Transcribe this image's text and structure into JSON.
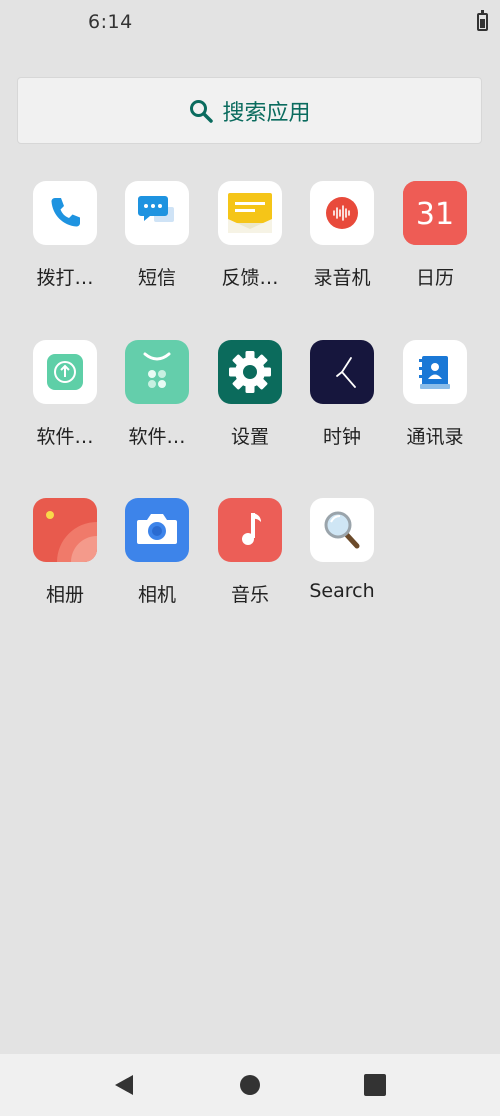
{
  "status_bar": {
    "time": "6:14",
    "battery_icon": "battery-icon"
  },
  "search": {
    "label": "搜索应用",
    "icon": "search-icon"
  },
  "apps": [
    {
      "label": "拨打…",
      "icon": "phone-icon"
    },
    {
      "label": "短信",
      "icon": "message-icon"
    },
    {
      "label": "反馈…",
      "icon": "feedback-icon"
    },
    {
      "label": "录音机",
      "icon": "recorder-icon"
    },
    {
      "label": "日历",
      "icon": "calendar-icon",
      "badge": "31"
    },
    {
      "label": "软件…",
      "icon": "update-icon"
    },
    {
      "label": "软件…",
      "icon": "store-icon"
    },
    {
      "label": "设置",
      "icon": "gear-icon"
    },
    {
      "label": "时钟",
      "icon": "clock-icon"
    },
    {
      "label": "通讯录",
      "icon": "contacts-icon"
    },
    {
      "label": "相册",
      "icon": "gallery-icon"
    },
    {
      "label": "相机",
      "icon": "camera-icon"
    },
    {
      "label": "音乐",
      "icon": "music-icon"
    },
    {
      "label": "Search",
      "icon": "magnifier-icon"
    }
  ],
  "nav": {
    "back": "back-icon",
    "home": "home-icon",
    "recents": "recents-icon"
  },
  "colors": {
    "search_accent": "#0a6b5e",
    "background": "#e3e3e3"
  }
}
